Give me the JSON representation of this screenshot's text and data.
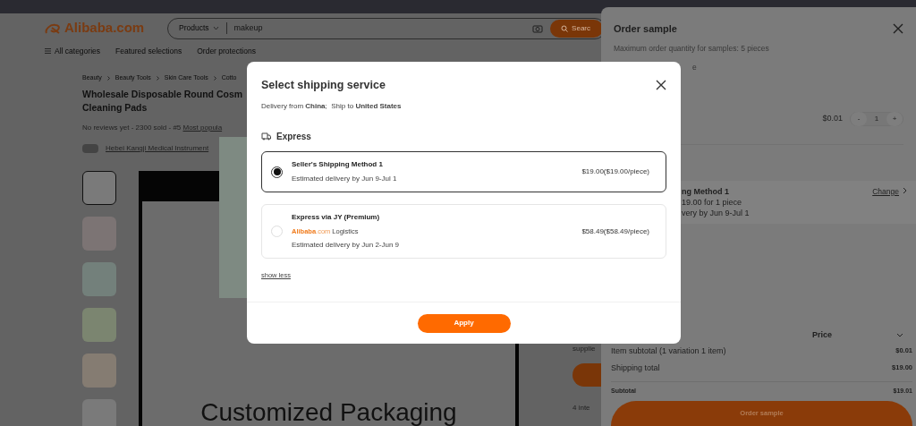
{
  "header": {
    "logo": "Alibaba.com",
    "search": {
      "scope": "Products",
      "value": "makeup",
      "button": "Searc"
    },
    "nav": [
      "All categories",
      "Featured selections",
      "Order protections"
    ]
  },
  "product": {
    "breadcrumbs": [
      "Beauty",
      "Beauty Tools",
      "Skin Care Tools",
      "Cotto"
    ],
    "title_lines": [
      "Wholesale Disposable Round Cosm",
      "Cleaning Pads"
    ],
    "stats": "No reviews yet - 2300 sold - #5 ",
    "ranking_link": "Most popula",
    "supplier": "Hebei Kangji Medical Instrument",
    "thumbnails": [
      {
        "selected": true
      },
      {
        "selected": false
      },
      {
        "selected": false
      },
      {
        "selected": false
      },
      {
        "selected": false
      },
      {
        "selected": false
      }
    ],
    "image_caption": "Customized Packaging",
    "side_texts": [
      "supplie",
      "4 inte"
    ]
  },
  "drawer": {
    "title": "Order sample",
    "note": "Maximum order quantity for samples: 5 pieces",
    "fragment": "e",
    "unit_price": "$0.01",
    "decrement": "-",
    "quantity": "1",
    "increment": "+",
    "shipping": {
      "method": "ng Method 1",
      "cost": "19.00 for 1 piece",
      "delivery": "very by Jun 9-Jul 1",
      "change": "Change"
    },
    "price": {
      "title": "Price",
      "rows": [
        {
          "kind": "line",
          "label": "Item subtotal (1 variation 1 item)",
          "value": "$0.01"
        },
        {
          "kind": "line",
          "label": "Shipping total",
          "value": "$19.00"
        },
        {
          "kind": "total",
          "label": "Subtotal",
          "value": "$19.01"
        }
      ]
    },
    "button": "Order sample"
  },
  "dialog": {
    "title": "Select shipping service",
    "route": "Delivery from **China**;  Ship to **United States**",
    "section": "Express",
    "options": [
      {
        "name": "Seller's Shipping Method 1",
        "delivery": "Estimated delivery by Jun 9-Jul 1",
        "price": "$19.00($19.00/piece)",
        "selected": true
      },
      {
        "name": "Express via JY (Premium)",
        "carrier": {
          "brand": "Alibaba",
          "suffix": ".com",
          "label": "Logistics"
        },
        "delivery": "Estimated delivery by Jun 2-Jun 9",
        "price": "$58.49($58.49/piece)",
        "selected": false
      }
    ],
    "toggle": "show less",
    "button": "Apply"
  }
}
